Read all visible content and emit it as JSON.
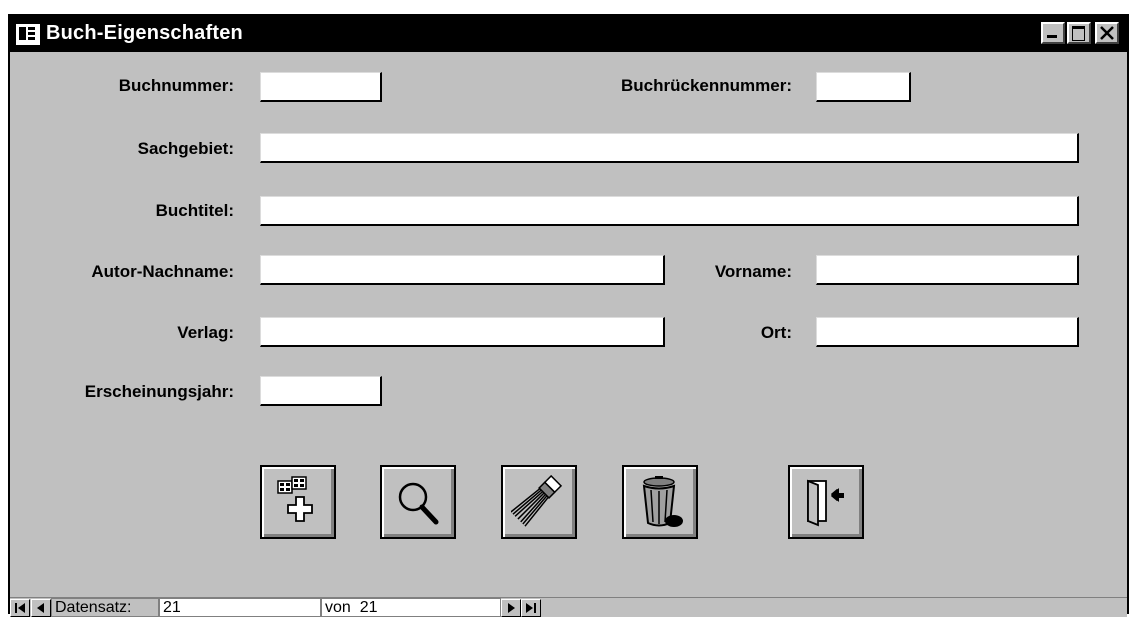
{
  "window": {
    "title": "Buch-Eigenschaften"
  },
  "form": {
    "fields": [
      {
        "label": "Buchnummer:",
        "value": ""
      },
      {
        "label": "Buchrückennummer:",
        "value": ""
      },
      {
        "label": "Sachgebiet:",
        "value": ""
      },
      {
        "label": "Buchtitel:",
        "value": ""
      },
      {
        "label": "Autor-Nachname:",
        "value": ""
      },
      {
        "label": "Vorname:",
        "value": ""
      },
      {
        "label": "Verlag:",
        "value": ""
      },
      {
        "label": "Ort:",
        "value": ""
      },
      {
        "label": "Erscheinungsjahr:",
        "value": ""
      }
    ]
  },
  "toolbar": {
    "icons": [
      "new-record-icon",
      "search-icon",
      "broom-icon",
      "trash-can-icon",
      "exit-door-icon"
    ]
  },
  "navigator": {
    "record_label": "Datensatz:",
    "current_record": "21",
    "of_label": "von",
    "total_records": "21"
  }
}
